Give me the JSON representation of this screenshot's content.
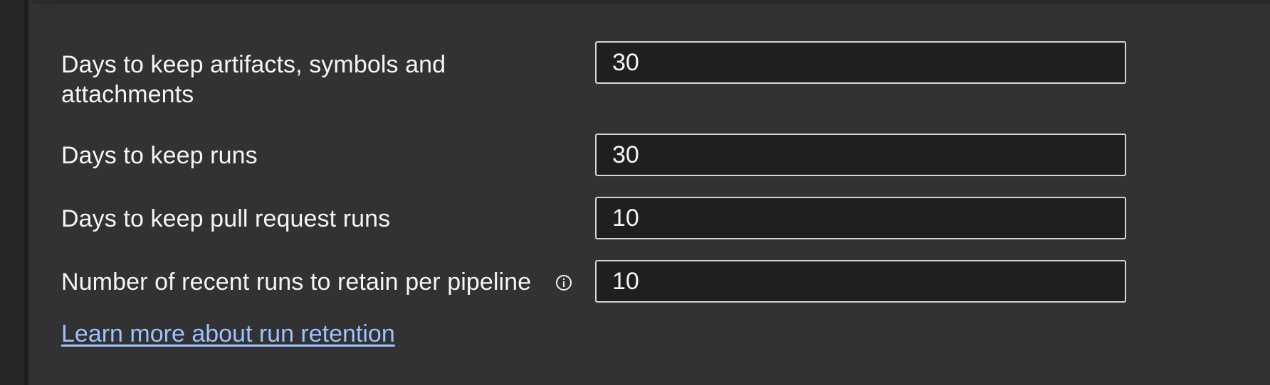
{
  "settings": {
    "fields": [
      {
        "label": "Days to keep artifacts, symbols and attachments",
        "value": "30"
      },
      {
        "label": "Days to keep runs",
        "value": "30"
      },
      {
        "label": "Days to keep pull request runs",
        "value": "10"
      },
      {
        "label": "Number of recent runs to retain per pipeline",
        "value": "10"
      }
    ],
    "link_text": "Learn more about run retention"
  },
  "icons": {
    "info": "info-icon"
  },
  "colors": {
    "background": "#323232",
    "input_background": "#1f1f1f",
    "input_border": "#d6d6d6",
    "link": "#9cc2ff",
    "text": "#f5f5f5"
  }
}
